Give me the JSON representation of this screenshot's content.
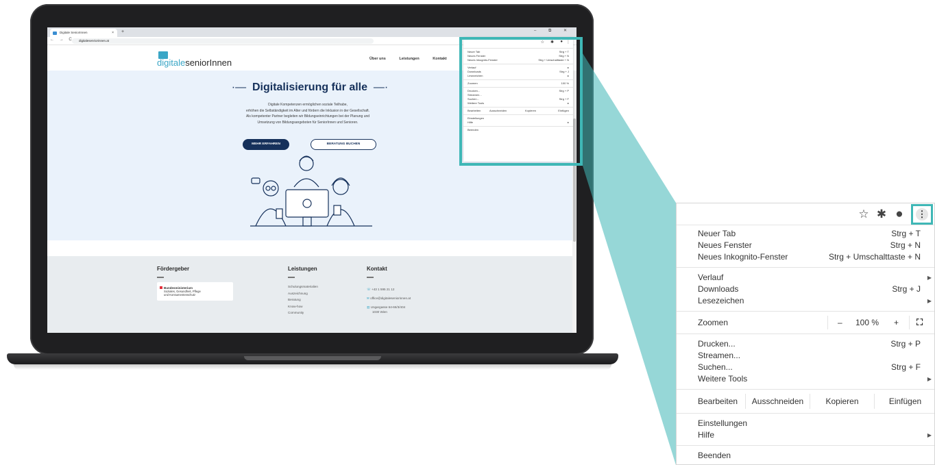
{
  "browser": {
    "tab_title": "Digitale SeniorInnen",
    "tab_close": "×",
    "new_tab": "+",
    "window_controls": "–  ⧉  ✕",
    "nav_icons": "←  →  C",
    "url": "digitalesenriorinnen.at"
  },
  "site": {
    "logo_prefix": "digitale",
    "logo_suffix": "seniorInnen",
    "nav": [
      "Über uns",
      "Leistungen",
      "Kontakt"
    ],
    "hero_title": "Digitalisierung für alle",
    "hero_lines": [
      "Digitale Kompetenzen ermöglichen soziale Teilhabe,",
      "erhöhen die Selbständigkeit im Alter und fördern die Inklusion in der Gesellschaft.",
      "Als kompetenter Partner begleiten wir Bildungseinrichtungen bei der Planung und",
      "Umsetzung von Bildungsangeboten für SeniorInnen und Senioren."
    ],
    "btn_primary": "MEHR ERFAHREN",
    "btn_secondary": "BERATUNG BUCHEN",
    "footer": {
      "col1_title": "Fördergeber",
      "sponsor_name": "Bundesministerium",
      "sponsor_line1": "Soziales, Gesundheit, Pflege",
      "sponsor_line2": "und Konsumentenschutz",
      "col2_title": "Leistungen",
      "col2_items": [
        "Schulungsmaterialien",
        "Auszeichnung",
        "Beratung",
        "Know-how",
        "Community"
      ],
      "col3_title": "Kontakt",
      "phone": "+43 1 595 21 12",
      "email": "office@digitaleseniorinnen.at",
      "address1": "Ungargasse 64-66/3/404",
      "address2": "1030 Wien"
    }
  },
  "menu": {
    "toolbar_icons": [
      "star-icon",
      "puzzle-icon",
      "account-icon",
      "kebab-menu-icon"
    ],
    "items_group1": [
      {
        "label": "Neuer Tab",
        "shortcut": "Strg + T"
      },
      {
        "label": "Neues Fenster",
        "shortcut": "Strg + N"
      },
      {
        "label": "Neues Inkognito-Fenster",
        "shortcut": "Strg + Umschalttaste + N"
      }
    ],
    "items_group2": [
      {
        "label": "Verlauf",
        "shortcut": "",
        "submenu": true
      },
      {
        "label": "Downloads",
        "shortcut": "Strg + J",
        "submenu": false
      },
      {
        "label": "Lesezeichen",
        "shortcut": "",
        "submenu": true
      }
    ],
    "zoom_label": "Zoomen",
    "zoom_minus": "–",
    "zoom_value": "100 %",
    "zoom_plus": "+",
    "items_group3": [
      {
        "label": "Drucken...",
        "shortcut": "Strg + P",
        "submenu": false
      },
      {
        "label": "Streamen...",
        "shortcut": "",
        "submenu": false
      },
      {
        "label": "Suchen...",
        "shortcut": "Strg + F",
        "submenu": false
      },
      {
        "label": "Weitere Tools",
        "shortcut": "",
        "submenu": true
      }
    ],
    "edit_label": "Bearbeiten",
    "edit_cut": "Ausschneiden",
    "edit_copy": "Kopieren",
    "edit_paste": "Einfügen",
    "settings": "Einstellungen",
    "help": "Hilfe",
    "exit": "Beenden"
  },
  "colors": {
    "highlight": "#3fb7b6",
    "brand_dark": "#16315b",
    "brand_light": "#3aa6c6"
  }
}
